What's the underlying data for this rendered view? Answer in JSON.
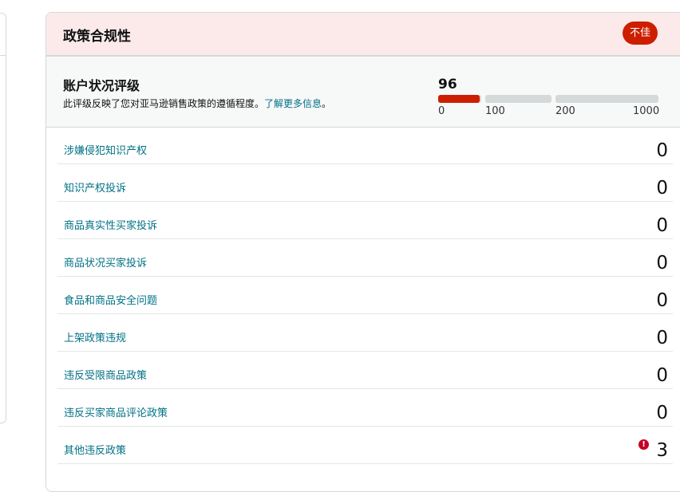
{
  "card": {
    "title": "政策合规性",
    "status_badge": "不佳"
  },
  "rating": {
    "title": "账户状况评级",
    "description": "此评级反映了您对亚马逊销售政策的遵循程度。",
    "learn_more": "了解更多信息",
    "period": "。",
    "score": "96",
    "score_value": 96,
    "ticks": [
      "0",
      "100",
      "200",
      "1000"
    ],
    "colors": {
      "bad": "#cc1f00",
      "track": "#d5d9d9"
    }
  },
  "violations": [
    {
      "label": "涉嫌侵犯知识产权",
      "count": "0"
    },
    {
      "label": "知识产权投诉",
      "count": "0"
    },
    {
      "label": "商品真实性买家投诉",
      "count": "0"
    },
    {
      "label": "商品状况买家投诉",
      "count": "0"
    },
    {
      "label": "食品和商品安全问题",
      "count": "0"
    },
    {
      "label": "上架政策违规",
      "count": "0"
    },
    {
      "label": "违反受限商品政策",
      "count": "0"
    },
    {
      "label": "违反买家商品评论政策",
      "count": "0"
    },
    {
      "label": "其他违反政策",
      "count": "3",
      "warning_icon": "exclamation-circle-icon"
    }
  ]
}
